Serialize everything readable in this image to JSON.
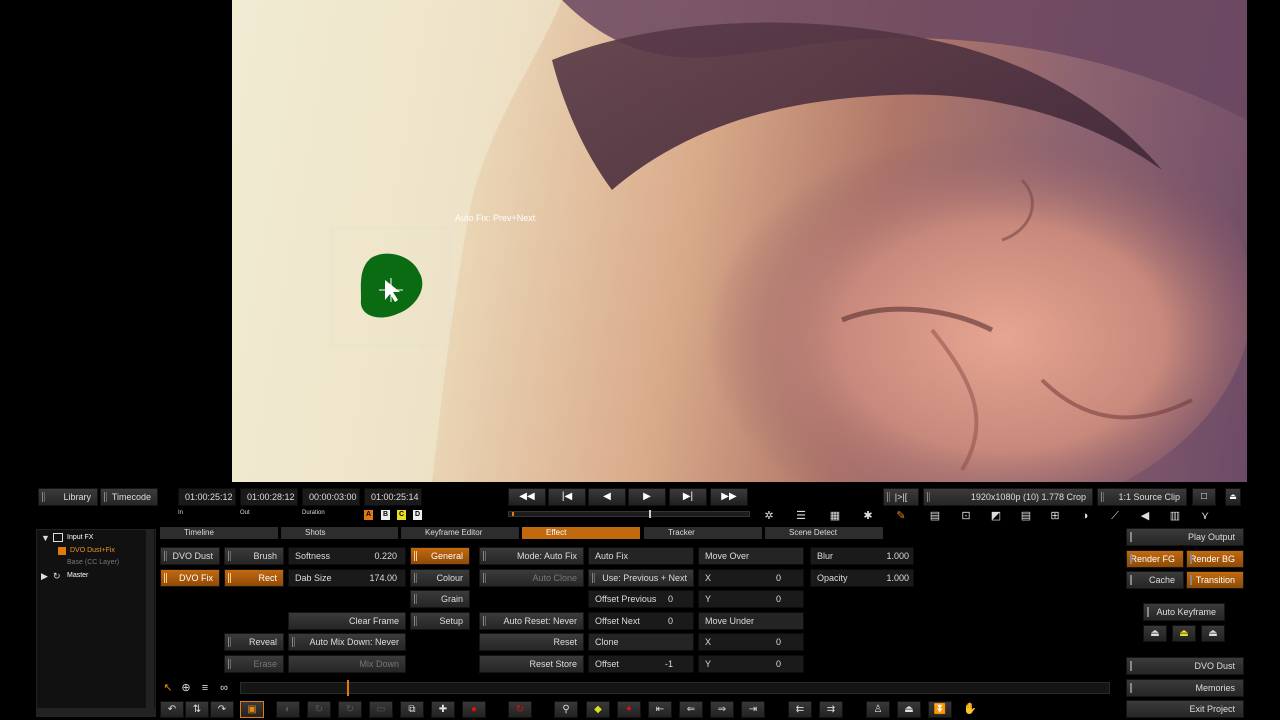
{
  "viewer": {
    "overlay_label": "Auto Fix: Prev+Next"
  },
  "top_bar": {
    "library": "Library",
    "timecode": "Timecode",
    "in_tc": "01:00:25:12",
    "in_lbl": "In",
    "out_tc": "01:00:28:12",
    "out_lbl": "Out",
    "dur_tc": "00:00:03:00",
    "dur_lbl": "Duration",
    "cur_tc": "01:00:25:14",
    "layers": [
      "A",
      "B",
      "C",
      "D"
    ],
    "bracket": "|>|[",
    "format": "1920x1080p (10) 1.778 Crop",
    "source": "1:1 Source Clip"
  },
  "tree": {
    "items": [
      "Input FX",
      "DVO Dust+Fix",
      "Base (CC Layer)",
      "Master"
    ]
  },
  "tabs": [
    "Timeline",
    "Shots",
    "Keyframe Editor",
    "Effect",
    "Tracker",
    "Scene Detect"
  ],
  "panel": {
    "dvo_dust": "DVO Dust",
    "dvo_fix": "DVO Fix",
    "brush": "Brush",
    "rect": "Rect",
    "softness_lbl": "Softness",
    "softness": "0.220",
    "dab_lbl": "Dab Size",
    "dab": "174.00",
    "clear_frame": "Clear Frame",
    "reveal": "Reveal",
    "auto_mix": "Auto Mix Down: Never",
    "erase": "Erase",
    "mix_down": "Mix Down",
    "general": "General",
    "colour": "Colour",
    "grain": "Grain",
    "setup": "Setup",
    "mode": "Mode: Auto Fix",
    "auto_clone": "Auto Clone",
    "auto_reset": "Auto Reset: Never",
    "reset": "Reset",
    "reset_store": "Reset Store",
    "auto_fix": "Auto Fix",
    "use_prev_next": "Use: Previous + Next",
    "offset_prev_lbl": "Offset Previous",
    "offset_prev": "0",
    "offset_next_lbl": "Offset Next",
    "offset_next": "0",
    "clone": "Clone",
    "offset_lbl": "Offset",
    "offset": "-1",
    "move_over": "Move Over",
    "x_lbl": "X",
    "x1": "0",
    "y_lbl": "Y",
    "y1": "0",
    "move_under": "Move Under",
    "x2": "0",
    "y2": "0",
    "blur_lbl": "Blur",
    "blur": "1.000",
    "opacity_lbl": "Opacity",
    "opacity": "1.000"
  },
  "right": {
    "play_output": "Play Output",
    "render_fg": "Render FG",
    "render_bg": "Render BG",
    "cache": "Cache",
    "transition": "Transition",
    "auto_keyframe": "Auto Keyframe",
    "dvo_dust": "DVO Dust",
    "memories": "Memories",
    "exit": "Exit Project"
  },
  "colors": {
    "accent": "#c0690f",
    "mask": "#0a6b12"
  }
}
